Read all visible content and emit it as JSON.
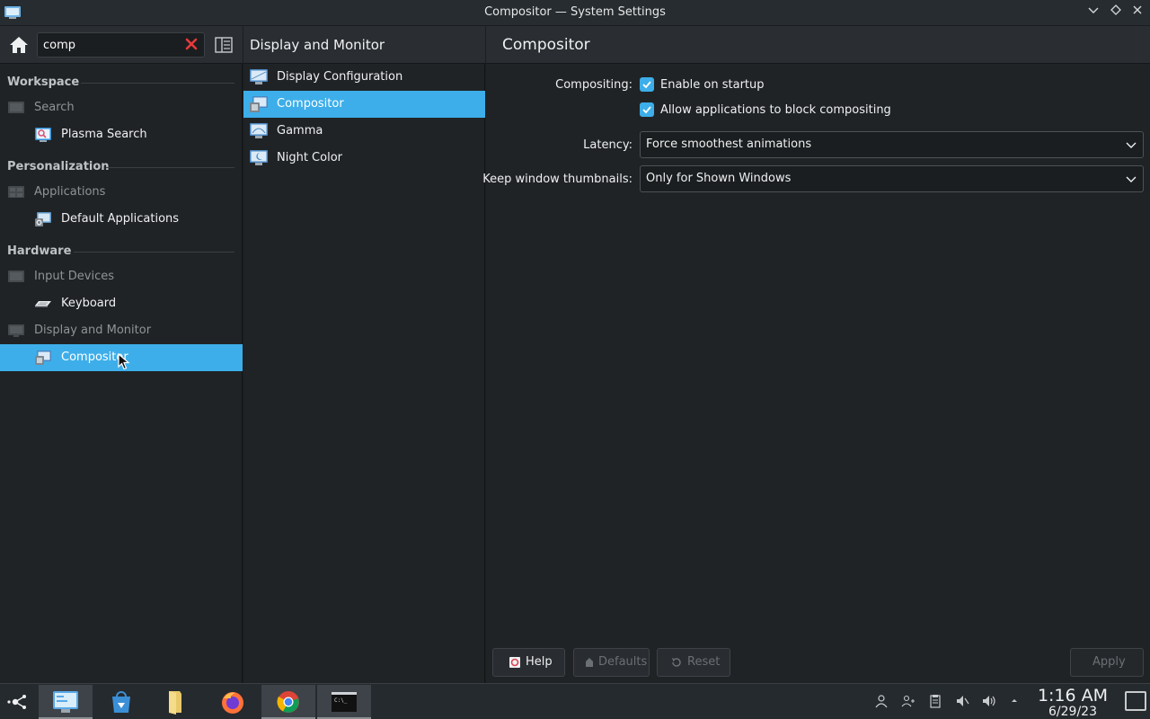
{
  "window": {
    "title": "Compositor — System Settings"
  },
  "sidebar": {
    "search_value": "comp",
    "sections": [
      {
        "label": "Workspace",
        "category": "Search",
        "items": [
          {
            "label": "Plasma Search",
            "icon": "plasma-search-icon"
          }
        ]
      },
      {
        "label": "Personalization",
        "category": "Applications",
        "items": [
          {
            "label": "Default Applications",
            "icon": "default-applications-icon"
          }
        ]
      },
      {
        "label": "Hardware",
        "category": "Input Devices",
        "items": [
          {
            "label": "Keyboard",
            "icon": "keyboard-icon"
          }
        ]
      },
      {
        "label": "",
        "category": "Display and Monitor",
        "items": [
          {
            "label": "Compositor",
            "icon": "compositor-icon",
            "selected": true
          }
        ]
      }
    ]
  },
  "middle": {
    "title": "Display and Monitor",
    "items": [
      {
        "label": "Display Configuration"
      },
      {
        "label": "Compositor",
        "selected": true
      },
      {
        "label": "Gamma"
      },
      {
        "label": "Night Color"
      }
    ]
  },
  "main": {
    "title": "Compositor",
    "compositing_label": "Compositing:",
    "enable_on_startup": {
      "label": "Enable on startup",
      "checked": true
    },
    "allow_block": {
      "label": "Allow applications to block compositing",
      "checked": true
    },
    "latency_label": "Latency:",
    "latency_value": "Force smoothest animations",
    "thumbnails_label": "Keep window thumbnails:",
    "thumbnails_value": "Only for Shown Windows",
    "buttons": {
      "help": "Help",
      "defaults": "Defaults",
      "reset": "Reset",
      "apply": "Apply"
    }
  },
  "taskbar": {
    "clock_time": "1:16 AM",
    "clock_date": "6/29/23",
    "apps": [
      "application-launcher-icon",
      "system-settings-icon",
      "discover-store-icon",
      "file-manager-icon",
      "firefox-icon",
      "chrome-icon",
      "terminal-icon"
    ],
    "tray": [
      "user-icon",
      "network-icon",
      "clipboard-icon",
      "muted-speaker-icon",
      "volume-icon",
      "expand-tray-icon"
    ]
  },
  "colors": {
    "accent": "#3daee9",
    "background": "#202326",
    "header": "#2a2e32",
    "taskbar": "#252a2e"
  }
}
